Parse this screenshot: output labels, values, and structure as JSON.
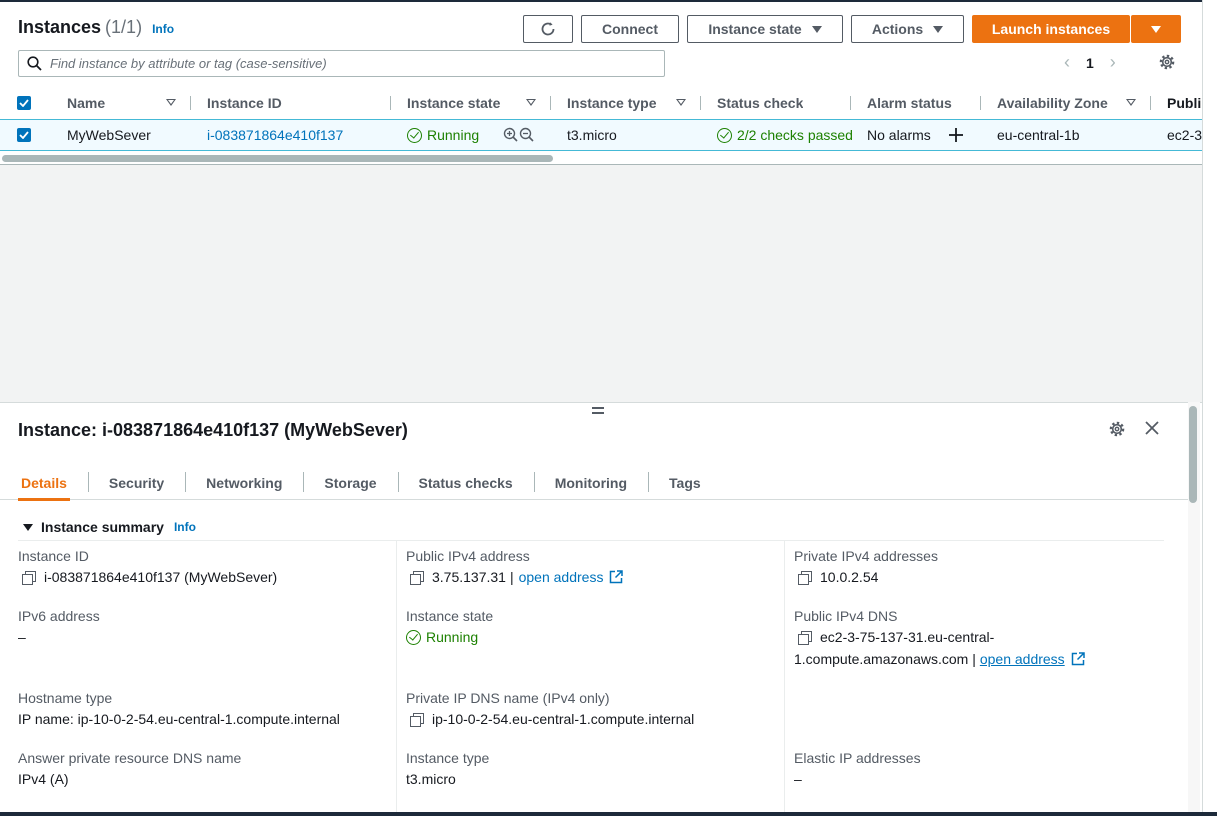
{
  "header": {
    "title": "Instances",
    "count": "(1/1)",
    "info": "Info"
  },
  "toolbar": {
    "connect_label": "Connect",
    "instance_state_label": "Instance state",
    "actions_label": "Actions",
    "launch_label": "Launch instances"
  },
  "search": {
    "placeholder": "Find instance by attribute or tag (case-sensitive)"
  },
  "pagination": {
    "page": "1"
  },
  "table": {
    "columns": [
      "Name",
      "Instance ID",
      "Instance state",
      "Instance type",
      "Status check",
      "Alarm status",
      "Availability Zone",
      "Publi"
    ],
    "row": {
      "name": "MyWebSever",
      "instance_id": "i-083871864e410f137",
      "state": "Running",
      "type": "t3.micro",
      "status_check": "2/2 checks passed",
      "alarm_status": "No alarms",
      "availability_zone": "eu-central-1b",
      "public_dns": "ec2-3"
    }
  },
  "detail": {
    "title": "Instance: i-083871864e410f137 (MyWebSever)",
    "tabs": [
      "Details",
      "Security",
      "Networking",
      "Storage",
      "Status checks",
      "Monitoring",
      "Tags"
    ],
    "summary_title": "Instance summary",
    "summary_info": "Info",
    "fields": {
      "instance_id_label": "Instance ID",
      "instance_id_value": "i-083871864e410f137 (MyWebSever)",
      "public_ipv4_label": "Public IPv4 address",
      "public_ipv4_value": "3.75.137.31",
      "public_ipv4_sep": "|",
      "open_address": "open address",
      "private_ipv4_label": "Private IPv4 addresses",
      "private_ipv4_value": "10.0.2.54",
      "ipv6_label": "IPv6 address",
      "ipv6_value": "–",
      "instance_state_label": "Instance state",
      "instance_state_value": "Running",
      "public_dns_label": "Public IPv4 DNS",
      "public_dns_line1": "ec2-3-75-137-31.eu-central-",
      "public_dns_line2": "1.compute.amazonaws.com |",
      "open_address_2": "open address",
      "hostname_type_label": "Hostname type",
      "hostname_type_value": "IP name: ip-10-0-2-54.eu-central-1.compute.internal",
      "private_dns_label": "Private IP DNS name (IPv4 only)",
      "private_dns_value": "ip-10-0-2-54.eu-central-1.compute.internal",
      "answer_dns_label": "Answer private resource DNS name",
      "answer_dns_value": "IPv4 (A)",
      "instance_type_label": "Instance type",
      "instance_type_value": "t3.micro",
      "elastic_ip_label": "Elastic IP addresses",
      "elastic_ip_value": "–"
    }
  },
  "colors": {
    "accent": "#ec7211",
    "link": "#0073bb",
    "success": "#1d8102",
    "selected_row": "#f1faff"
  }
}
